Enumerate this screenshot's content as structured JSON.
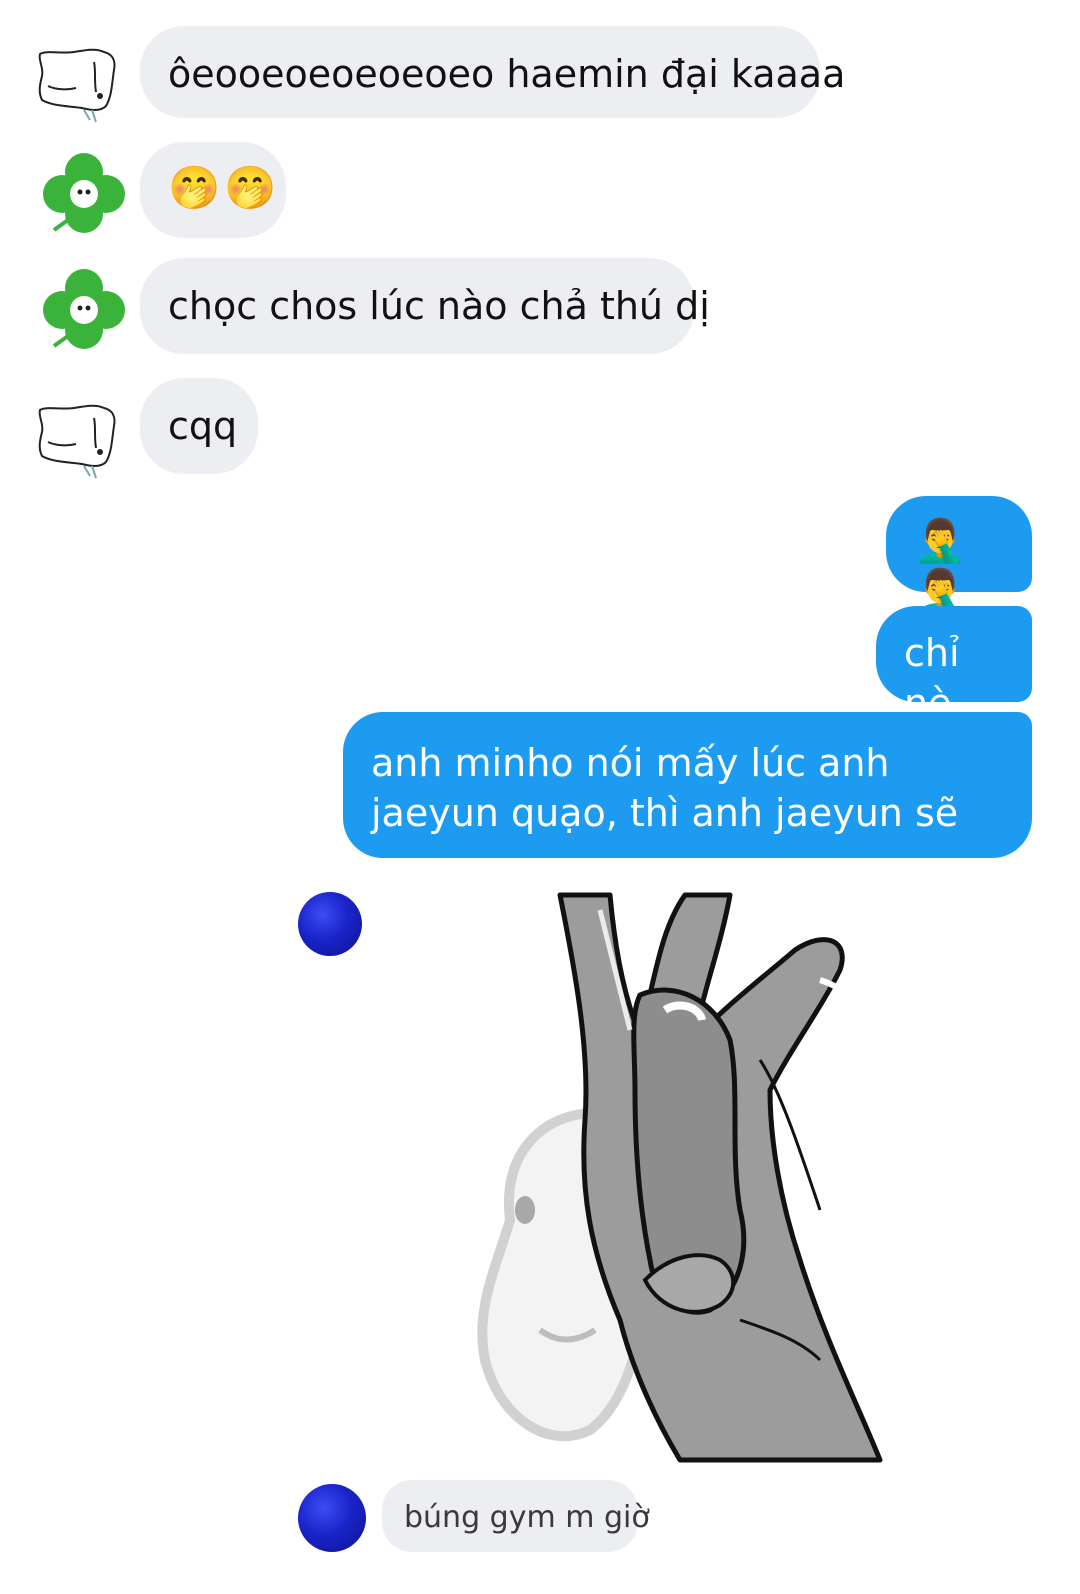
{
  "messages": [
    {
      "sender": "bear",
      "text": "ôeooeoeoeoeoeo haemin đại kaaaa"
    },
    {
      "sender": "clover",
      "text": "🤭🤭"
    },
    {
      "sender": "clover",
      "text": "chọc chos lúc nào chả thú dị"
    },
    {
      "sender": "bear",
      "text": "cqq"
    },
    {
      "sender": "me",
      "text": "🤦‍♂️🤦‍♂️"
    },
    {
      "sender": "me",
      "text": "chỉ nè"
    },
    {
      "sender": "me",
      "text": "anh minho nói mấy lúc anh jaeyun quạo, thì anh jaeyun sẽ"
    },
    {
      "sender": "ball",
      "text": "búng gym m giờ"
    }
  ],
  "icons": {
    "bear_avatar": "sleeping-bear-avatar",
    "clover_avatar": "four-leaf-clover-avatar",
    "ball_avatar": "blue-ball-avatar",
    "sticker": "flexing-arm-meme-sticker"
  },
  "colors": {
    "incoming_bubble": "#eceef1",
    "outgoing_bubble": "#1d9bf0",
    "ball": "#1a23c9",
    "clover": "#3bb33b"
  }
}
